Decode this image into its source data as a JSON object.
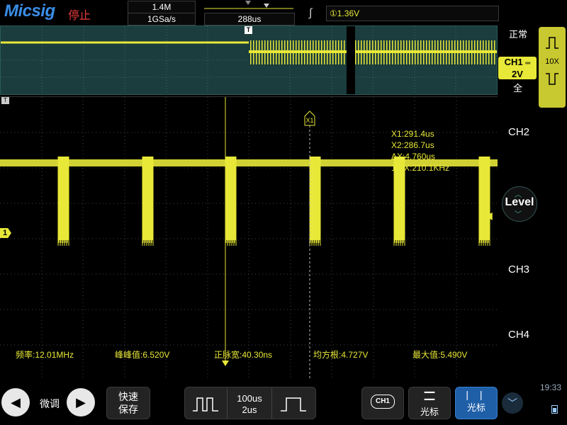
{
  "brand": {
    "logo": "Micsig",
    "run_status": "停止"
  },
  "top": {
    "memory_depth": "1.4M",
    "sample_rate": "1GSa/s",
    "time_position": "288us",
    "trigger_level": "①1.36V"
  },
  "right": {
    "acquire_mode": "正常",
    "ch1": {
      "label": "CH1",
      "scale": "2V",
      "coupling": "全"
    },
    "probe": "10X",
    "ch2": "CH2",
    "ch3": "CH3",
    "ch4": "CH4",
    "level": "Level",
    "clock": "19:33"
  },
  "cursor_readout": {
    "x1": "X1:291.4us",
    "x2": "X2:286.7us",
    "dx": "ΔX:4.760us",
    "inv_dx": "1/ΔX:210.1KHz",
    "x1_tag": "X1"
  },
  "measurements": [
    {
      "label": "频率:12.01MHz"
    },
    {
      "label": "峰峰值:6.520V"
    },
    {
      "label": "正脉宽:40.30ns"
    },
    {
      "label": "均方根:4.727V"
    },
    {
      "label": "最大值:5.490V"
    }
  ],
  "markers": {
    "trigger_tag": "T",
    "ch1_marker": "1"
  },
  "bottom": {
    "fine_label": "微调",
    "quick_save_line1": "快速",
    "quick_save_line2": "保存",
    "timebase_main": "100us",
    "timebase_zoom": "2us",
    "ch1_badge": "CH1",
    "cursor_label_1": "光标",
    "cursor_label_2": "光标"
  },
  "colors": {
    "trace": "#e8e838",
    "overview_bg": "#1b3d3d",
    "accent_blue": "#3a8ee8",
    "stop_red": "#e83a3a",
    "active_cursor_bg": "#1e5fa8"
  }
}
